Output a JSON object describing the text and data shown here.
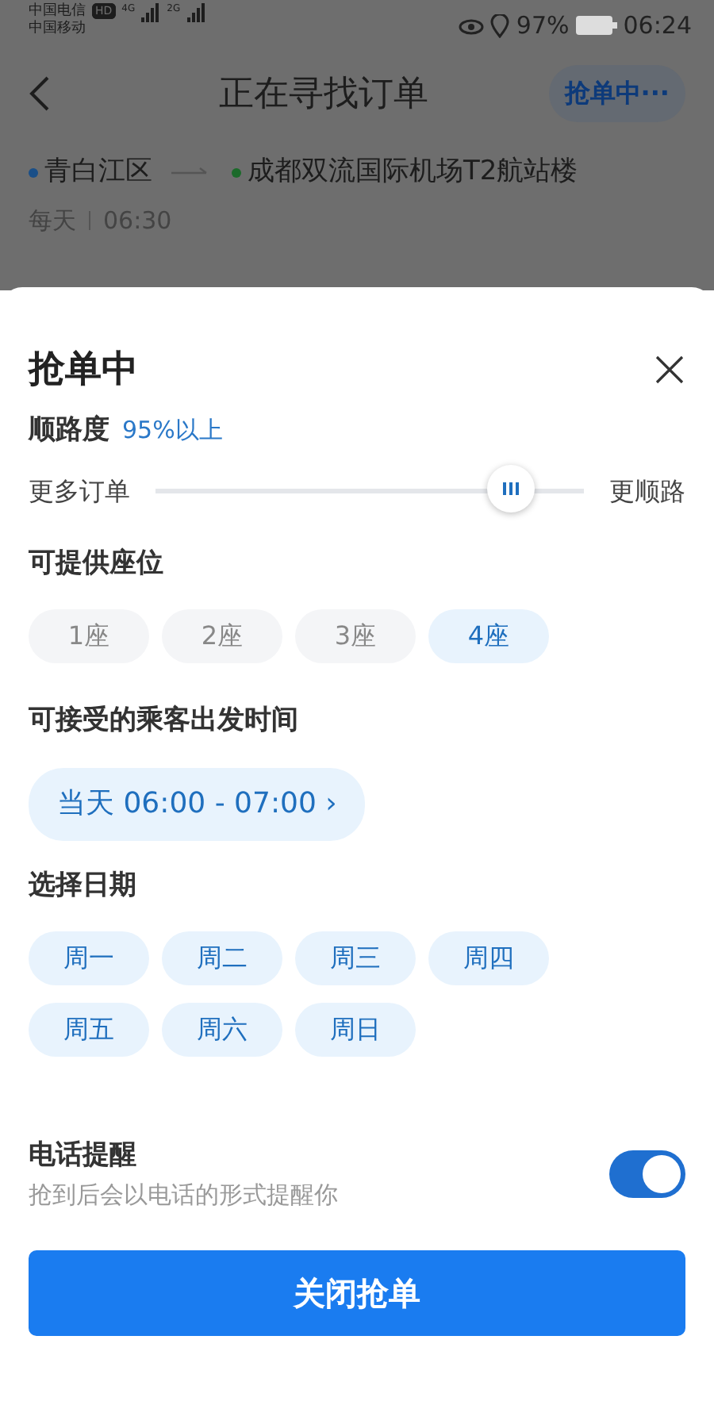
{
  "status_bar": {
    "carrier_1": "中国电信",
    "hd_badge": "HD",
    "network_1": "4G",
    "carrier_2": "中国移动",
    "network_2": "2G",
    "battery_percent": "97%",
    "time": "06:24"
  },
  "nav": {
    "title": "正在寻找订单",
    "status_button": "抢单中···"
  },
  "route": {
    "from": "青白江区",
    "to": "成都双流国际机场T2航站楼",
    "repeat": "每天",
    "time": "06:30"
  },
  "sheet": {
    "title": "抢单中",
    "detour": {
      "label": "顺路度",
      "value": "95%以上",
      "left_label": "更多订单",
      "right_label": "更顺路",
      "level": 0.83
    },
    "seats": {
      "label": "可提供座位",
      "options": [
        {
          "label": "1座",
          "selected": false
        },
        {
          "label": "2座",
          "selected": false
        },
        {
          "label": "3座",
          "selected": false
        },
        {
          "label": "4座",
          "selected": true
        }
      ]
    },
    "departure": {
      "label": "可接受的乘客出发时间",
      "value": "当天 06:00 - 07:00",
      "chevron": "›"
    },
    "days": {
      "label": "选择日期",
      "options": [
        {
          "label": "周一",
          "selected": true
        },
        {
          "label": "周二",
          "selected": true
        },
        {
          "label": "周三",
          "selected": true
        },
        {
          "label": "周四",
          "selected": true
        },
        {
          "label": "周五",
          "selected": true
        },
        {
          "label": "周六",
          "selected": true
        },
        {
          "label": "周日",
          "selected": true
        }
      ]
    },
    "phone_reminder": {
      "label": "电话提醒",
      "description": "抢到后会以电话的形式提醒你",
      "on": true
    },
    "close_button": "关闭抢单"
  }
}
